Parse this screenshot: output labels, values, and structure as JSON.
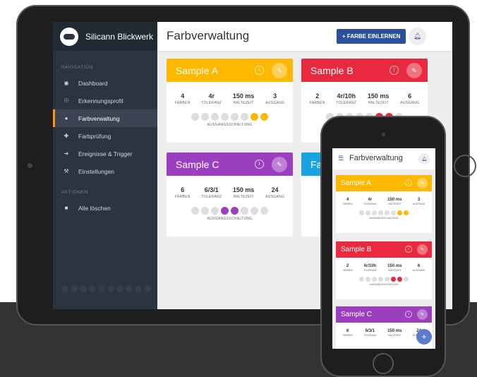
{
  "app": {
    "brand": "Silicann Blickwerk"
  },
  "sidebar": {
    "nav_heading": "NAVIGATION",
    "nav_items": [
      {
        "label": "Dashboard",
        "icon": "dashboard-icon"
      },
      {
        "label": "Erkennungsprofil",
        "icon": "eye-icon"
      },
      {
        "label": "Farbverwaltung",
        "icon": "drop-icon",
        "active": true
      },
      {
        "label": "Farbprüfung",
        "icon": "crosshair-icon"
      },
      {
        "label": "Ereignisse & Trigger",
        "icon": "bolt-icon"
      },
      {
        "label": "Einstellungen",
        "icon": "wrench-icon"
      }
    ],
    "actions_heading": "AKTIONEN",
    "action_items": [
      {
        "label": "Alle löschen",
        "icon": "trash-icon"
      }
    ]
  },
  "header": {
    "title": "Farbverwaltung",
    "add_label": "+ FARBE EINLERNEN"
  },
  "stat_labels": {
    "farben": "FARBEN",
    "toleranz": "TOLERANZ",
    "haltezeit": "HALTEZEIT",
    "ausgang": "AUSGANG"
  },
  "dots_label": "AUSGANGSSCHALTUNG",
  "cards": [
    {
      "title": "Sample A",
      "color": "#ffb800",
      "farben": "4",
      "toleranz": "4r",
      "haltezeit": "150 ms",
      "ausgang": "3",
      "outputs_on": [
        6,
        7
      ]
    },
    {
      "title": "Sample B",
      "color": "#e8293f",
      "farben": "2",
      "toleranz": "4r/10h",
      "haltezeit": "150 ms",
      "ausgang": "6",
      "outputs_on": [
        5,
        6
      ]
    },
    {
      "title": "Sample C",
      "color": "#9c3fbf",
      "farben": "6",
      "toleranz": "6/3/1",
      "haltezeit": "150 ms",
      "ausgang": "24",
      "outputs_on": [
        3,
        4
      ]
    },
    {
      "title": "Fa",
      "color": "#19a3e0",
      "farben": "",
      "toleranz": "",
      "haltezeit": "",
      "ausgang": "",
      "outputs_on": []
    }
  ],
  "phone": {
    "title": "Farbverwaltung",
    "cards": [
      {
        "title": "Sample A",
        "color": "#ffb800",
        "farben": "4",
        "toleranz": "4r",
        "haltezeit": "150 ms",
        "ausgang": "3",
        "outputs_on": [
          6,
          7
        ]
      },
      {
        "title": "Sample B",
        "color": "#e8293f",
        "farben": "2",
        "toleranz": "4r/10h",
        "haltezeit": "150 ms",
        "ausgang": "6",
        "outputs_on": [
          5,
          6
        ]
      },
      {
        "title": "Sample C",
        "color": "#9c3fbf",
        "farben": "6",
        "toleranz": "6/3/1",
        "haltezeit": "150 ms",
        "ausgang": "24",
        "outputs_on": []
      }
    ],
    "fab_label": "+"
  }
}
